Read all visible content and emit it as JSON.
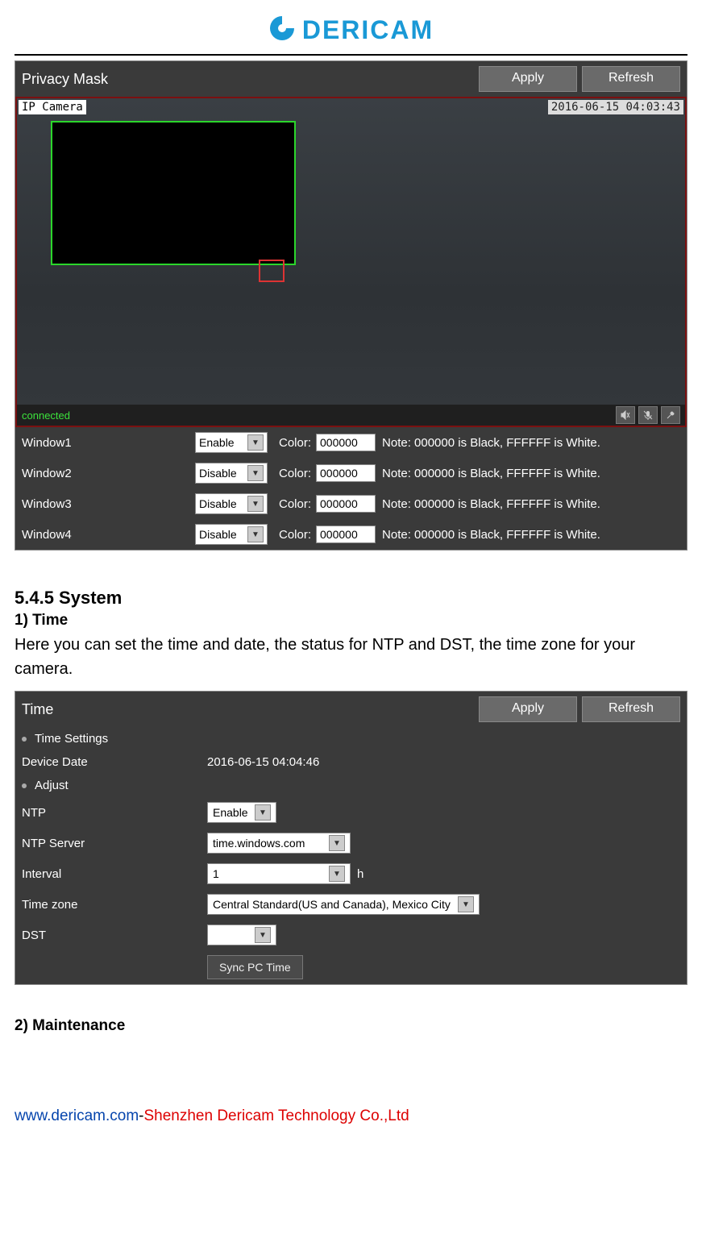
{
  "logo": {
    "text": "DERICAM"
  },
  "privacy": {
    "title": "Privacy Mask",
    "apply": "Apply",
    "refresh": "Refresh",
    "overlay_camera": "IP Camera",
    "overlay_timestamp": "2016-06-15 04:03:43",
    "connected": "connected",
    "color_label": "Color:",
    "note_text": "Note: 000000 is Black, FFFFFF is White.",
    "windows": [
      {
        "label": "Window1",
        "enable": "Enable",
        "color": "000000"
      },
      {
        "label": "Window2",
        "enable": "Disable",
        "color": "000000"
      },
      {
        "label": "Window3",
        "enable": "Disable",
        "color": "000000"
      },
      {
        "label": "Window4",
        "enable": "Disable",
        "color": "000000"
      }
    ]
  },
  "doc": {
    "section_title": "5.4.5 System",
    "sub_time_title": "1) Time",
    "time_desc": "Here you can set the time and date, the status for NTP and DST, the time zone for your camera.",
    "sub_maintenance": "2) Maintenance"
  },
  "time": {
    "title": "Time",
    "apply": "Apply",
    "refresh": "Refresh",
    "time_settings_heading": "Time Settings",
    "device_date_label": "Device Date",
    "device_date_value": "2016-06-15 04:04:46",
    "adjust_heading": "Adjust",
    "ntp_label": "NTP",
    "ntp_value": "Enable",
    "ntp_server_label": "NTP Server",
    "ntp_server_value": "time.windows.com",
    "interval_label": "Interval",
    "interval_value": "1",
    "interval_unit": "h",
    "timezone_label": "Time zone",
    "timezone_value": "Central Standard(US and Canada), Mexico City",
    "dst_label": "DST",
    "dst_value": "",
    "sync_btn": "Sync PC Time"
  },
  "footer": {
    "link": "www.dericam.com",
    "dash": "-",
    "company": "Shenzhen Dericam Technology Co.,Ltd"
  }
}
